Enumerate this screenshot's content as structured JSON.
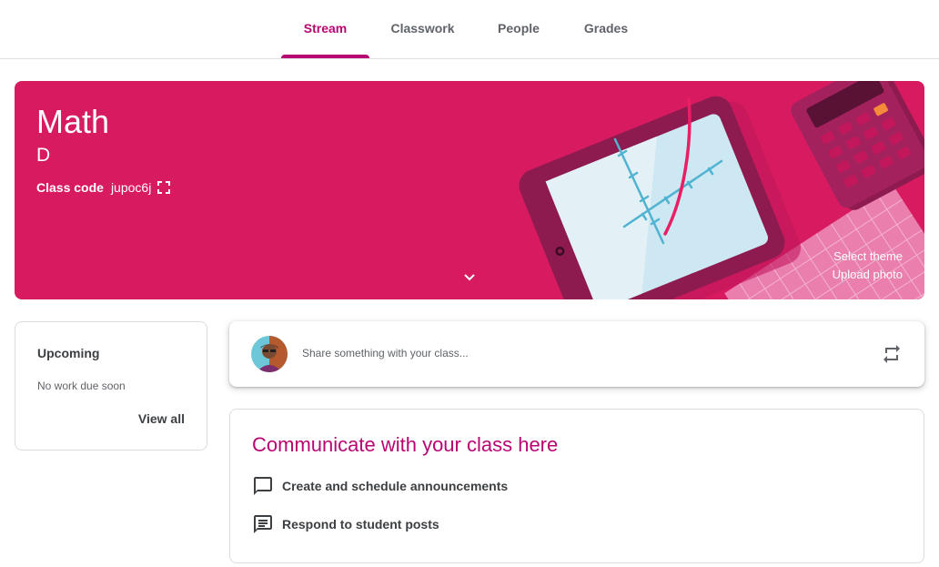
{
  "nav": {
    "tabs": [
      {
        "label": "Stream",
        "active": true
      },
      {
        "label": "Classwork",
        "active": false
      },
      {
        "label": "People",
        "active": false
      },
      {
        "label": "Grades",
        "active": false
      }
    ]
  },
  "banner": {
    "title": "Math",
    "section": "D",
    "class_code_label": "Class code",
    "class_code": "jupoc6j",
    "select_theme": "Select theme",
    "upload_photo": "Upload photo",
    "color": "#d81b60"
  },
  "upcoming": {
    "title": "Upcoming",
    "empty_text": "No work due soon",
    "view_all": "View all"
  },
  "share": {
    "placeholder": "Share something with your class..."
  },
  "communicate": {
    "title": "Communicate with your class here",
    "items": [
      {
        "icon": "comment-icon",
        "label": "Create and schedule announcements"
      },
      {
        "icon": "message-lines-icon",
        "label": "Respond to student posts"
      }
    ]
  },
  "colors": {
    "accent": "#b80672",
    "banner": "#d81b60"
  }
}
